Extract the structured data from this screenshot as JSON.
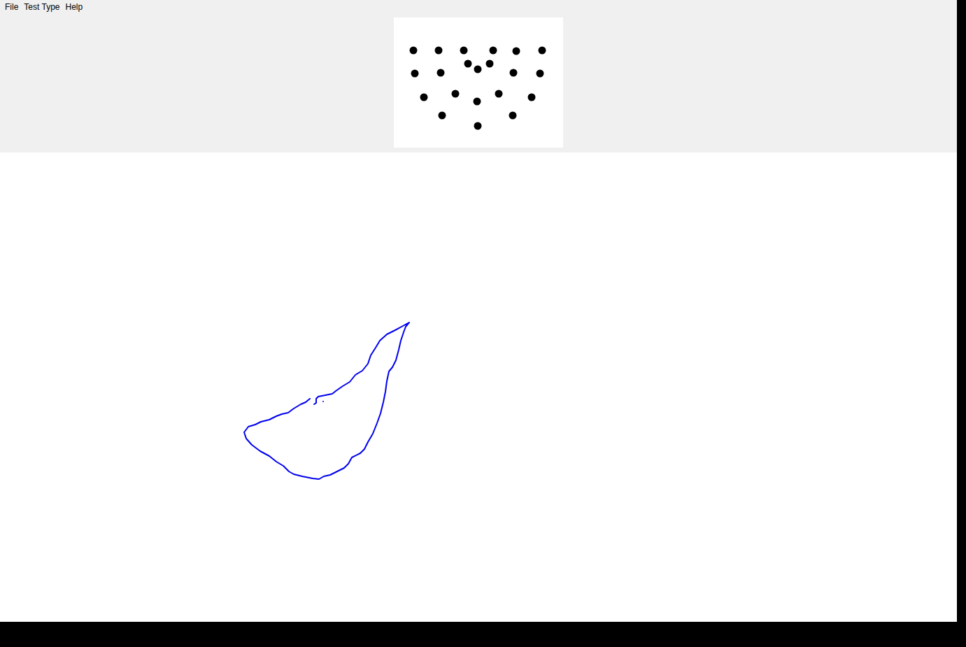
{
  "window": {
    "title": ""
  },
  "menu": [
    {
      "label": "File"
    },
    {
      "label": "Test Type"
    },
    {
      "label": "Help"
    }
  ]
}
